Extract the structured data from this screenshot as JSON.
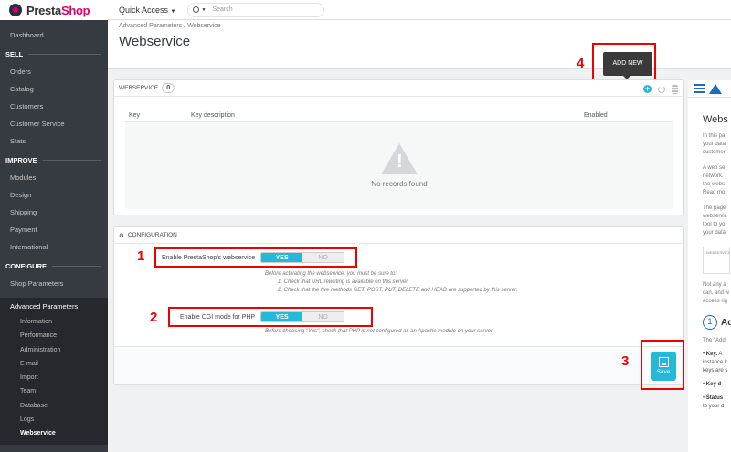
{
  "brand": {
    "name_a": "Presta",
    "name_b": "Shop"
  },
  "topbar": {
    "quick_access": "Quick Access",
    "search_placeholder": "Search"
  },
  "sidebar": {
    "dashboard": "Dashboard",
    "sections": [
      {
        "title": "SELL",
        "items": [
          "Orders",
          "Catalog",
          "Customers",
          "Customer Service",
          "Stats"
        ]
      },
      {
        "title": "IMPROVE",
        "items": [
          "Modules",
          "Design",
          "Shipping",
          "Payment",
          "International"
        ]
      },
      {
        "title": "CONFIGURE",
        "items": [
          "Shop Parameters"
        ]
      }
    ],
    "active_parent": "Advanced Parameters",
    "sub_items": [
      "Information",
      "Performance",
      "Administration",
      "E-mail",
      "Import",
      "Team",
      "Database",
      "Logs",
      "Webservice"
    ]
  },
  "header": {
    "breadcrumb_parent": "Advanced Parameters",
    "breadcrumb_sep": "/",
    "breadcrumb_current": "Webservice",
    "title": "Webservice"
  },
  "list_panel": {
    "title": "WEBSERVICE",
    "count": "0",
    "columns": [
      "Key",
      "Key description",
      "Enabled"
    ],
    "empty_text": "No records found"
  },
  "tooltip": "ADD NEW",
  "config_panel": {
    "title": "CONFIGURATION",
    "field1_label": "Enable PrestaShop's webservice",
    "field1_yes": "YES",
    "field1_no": "NO",
    "field1_help_1": "Before activating the webservice, you must be sure to:",
    "field1_help_2": "1. Check that URL rewriting is available on this server.",
    "field1_help_3": "2. Check that the five methods GET, POST, PUT, DELETE and HEAD are supported by this server.",
    "field2_label": "Enable CGI mode for PHP",
    "field2_yes": "YES",
    "field2_no": "NO",
    "field2_help": "Before choosing \"Yes\", check that PHP is not configured as an Apache module on your server.",
    "save": "Save"
  },
  "annotations": [
    "1",
    "2",
    "3",
    "4"
  ],
  "help": {
    "title": "Webs",
    "para1": "In this pa\nyour data\ncustomer",
    "para2": "A web se\nnetwork.\nthe webs\nRead mo",
    "para3": "The page\nwebservic\ntool to yo\nyour data",
    "thumb_text": "WEBSERVICE",
    "para4": "Not any a\ncan, and w\naccess rig",
    "step_number": "1",
    "step_title": "Ad",
    "step_sub": "The \"Add",
    "bullet1_label": "Key.",
    "bullet1_text": " A\ninstance k\nkeys are s",
    "bullet2_label": "Key d",
    "bullet3_label": "Status",
    "bullet3_text": "\nto your d"
  },
  "colors": {
    "accent": "#25b9d7",
    "highlight": "#e00000",
    "sidebar": "#363a41",
    "brand": "#df0067"
  }
}
